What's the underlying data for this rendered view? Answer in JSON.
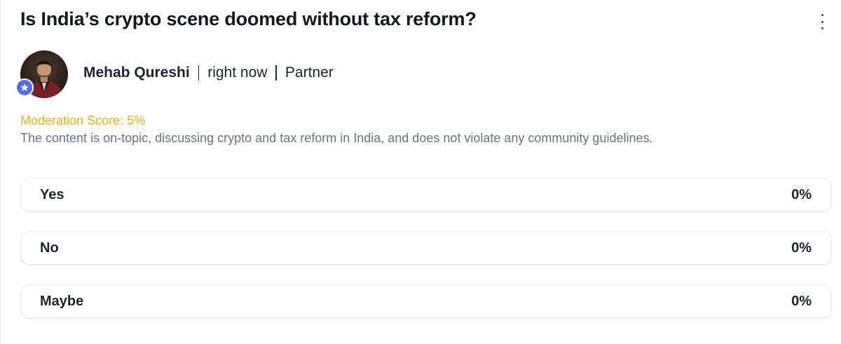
{
  "post": {
    "title": "Is India’s crypto scene doomed without tax reform?",
    "author": {
      "name": "Mehab Qureshi",
      "time": "right now",
      "role": "Partner"
    },
    "moderation": {
      "score_label": "Moderation Score: 5%",
      "description": "The content is on-topic, discussing crypto and tax reform in India, and does not violate any community guidelines."
    }
  },
  "poll": {
    "options": [
      {
        "label": "Yes",
        "percent": "0%",
        "fraction": 0
      },
      {
        "label": "No",
        "percent": "0%",
        "fraction": 0
      },
      {
        "label": "Maybe",
        "percent": "0%",
        "fraction": 0
      }
    ]
  },
  "icons": {
    "menu": "more-vertical-icon",
    "badge": "star-icon"
  },
  "colors": {
    "moderation_score": "#e5b219",
    "badge": "#4f6df5",
    "text": "#141821",
    "muted": "#6c7280"
  }
}
